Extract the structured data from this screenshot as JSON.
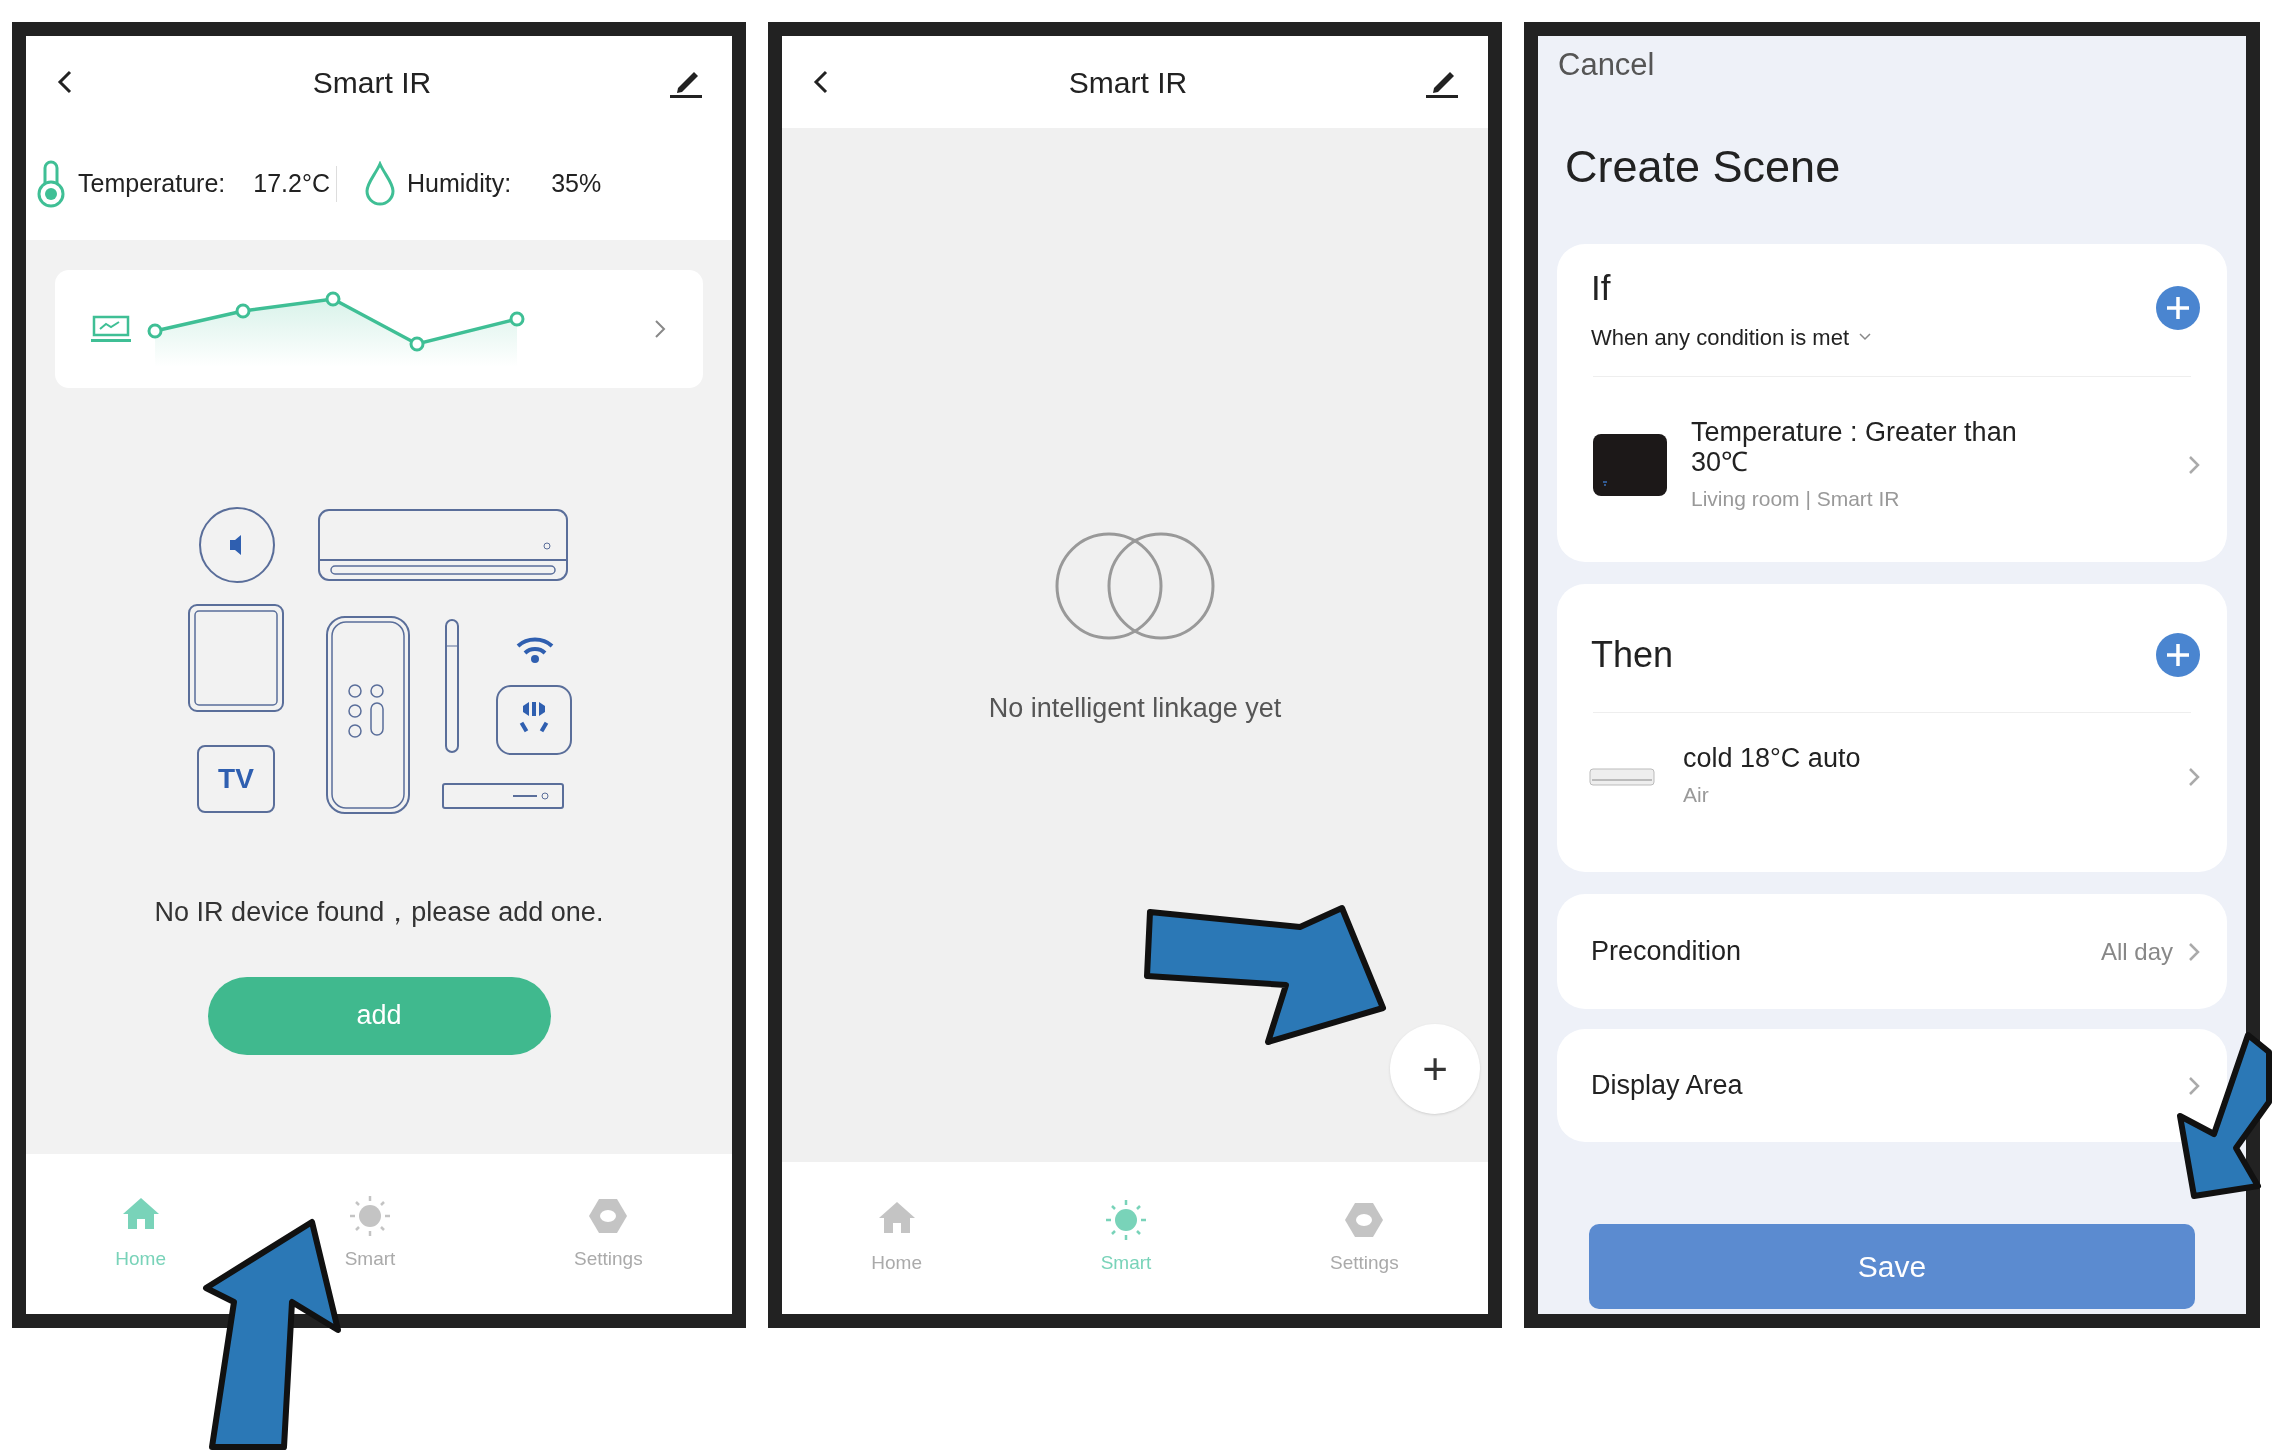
{
  "screen_home": {
    "title": "Smart IR",
    "temperature_label": "Temperature:",
    "temperature_value": "17.2°C",
    "humidity_label": "Humidity:",
    "humidity_value": "35%",
    "tv_label": "TV",
    "empty_message": "No IR device found，please add one.",
    "add_button": "add",
    "nav": [
      {
        "label": "Home",
        "kind": "home",
        "selected": true
      },
      {
        "label": "Smart",
        "kind": "smart",
        "selected": false
      },
      {
        "label": "Settings",
        "kind": "settings",
        "selected": false
      }
    ]
  },
  "screen_smart": {
    "title": "Smart IR",
    "empty_message": "No intelligent linkage yet",
    "fab": "+",
    "nav": [
      {
        "label": "Home",
        "kind": "home",
        "selected": false
      },
      {
        "label": "Smart",
        "kind": "smart",
        "selected": true
      },
      {
        "label": "Settings",
        "kind": "settings",
        "selected": false
      }
    ]
  },
  "screen_scene": {
    "cancel": "Cancel",
    "title": "Create Scene",
    "if_card": {
      "heading": "If",
      "mode": "When any condition is met",
      "item": {
        "title": "Temperature : Greater than 30℃",
        "subtitle": "Living room | Smart IR"
      }
    },
    "then_card": {
      "heading": "Then",
      "item": {
        "title": "cold 18°C auto",
        "subtitle": "Air"
      }
    },
    "precondition": {
      "label": "Precondition",
      "value": "All day"
    },
    "display_area": {
      "label": "Display Area"
    },
    "save_button": "Save"
  }
}
